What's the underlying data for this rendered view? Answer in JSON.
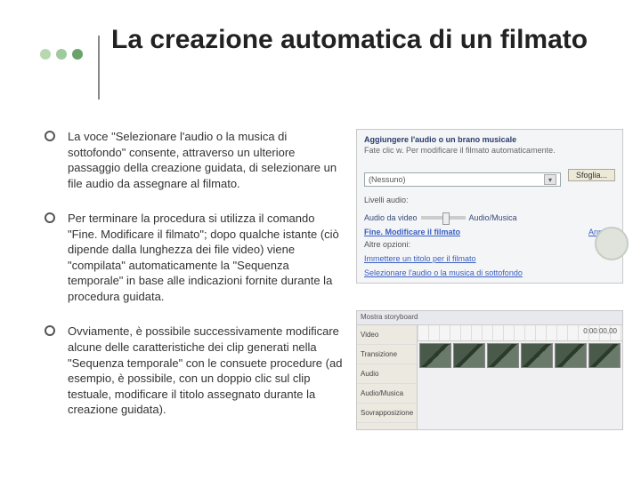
{
  "decor": {
    "colors": [
      "#b8d8b0",
      "#9fc99f",
      "#6aa36a"
    ]
  },
  "title": "La creazione automatica di un filmato",
  "bullets": [
    "La voce \"Selezionare l'audio o la musica di sottofondo\" consente, attraverso un ulteriore passaggio della creazione guidata, di selezionare un file audio da assegnare al filmato.",
    "Per terminare la procedura si utilizza il comando \"Fine. Modificare il filmato\"; dopo qualche istante (ciò dipende dalla lunghezza dei file video) viene \"compilata\" automaticamente la \"Sequenza temporale\" in base alle indicazioni fornite durante la procedura guidata.",
    "Ovviamente, è possibile successivamente modificare alcune delle caratteristiche dei clip generati nella \"Sequenza temporale\" con le consuete procedure (ad esempio, è possibile, con un doppio clic sul clip testuale, modificare il titolo assegnato durante la creazione guidata)."
  ],
  "panel1": {
    "header": "Aggiungere l'audio o un brano musicale",
    "sub": "Fate clic w. Per modificare il filmato automaticamente.",
    "select_value": "(Nessuno)",
    "browse_btn": "Sfoglia...",
    "lvl_label": "Livelli audio:",
    "lvl_left": "Audio da video",
    "lvl_right": "Audio/Musica",
    "link_main": "Fine. Modificare il filmato",
    "other": "Altre opzioni:",
    "link1": "Immettere un titolo per il filmato",
    "link2": "Selezionare l'audio o la musica di sottofondo",
    "cancel": "Annulla"
  },
  "panel2": {
    "header": "Mostra storyboard",
    "tools": [
      "0:00:00,00"
    ],
    "tabs": [
      "Video",
      "Transizione",
      "Audio",
      "Audio/Musica",
      "Sovrapposizione"
    ]
  }
}
